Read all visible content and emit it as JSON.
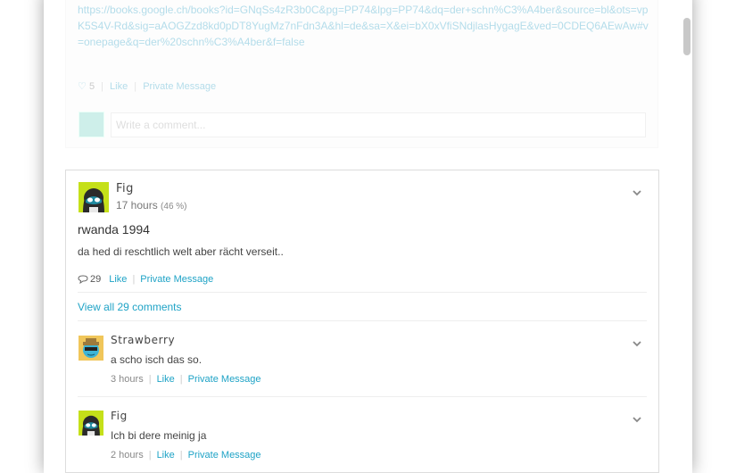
{
  "previous_post": {
    "link_text": "https://books.google.ch/books?id=GNqSs4zR3b0C&pg=PP74&lpg=PP74&dq=der+schn%C3%A4ber&source=bl&ots=vpK5S4V-Rd&sig=aAOGZzd8kd0pDT8YugMz7nFdn3A&hl=de&sa=X&ei=bX0xVfiSNdjlasHygagE&ved=0CDEQ6AEwAw#v=onepage&q=der%20schn%C3%A4ber&f=false",
    "likes_count": "5",
    "like_label": "Like",
    "pm_label": "Private Message",
    "comment_placeholder": "Write a comment..."
  },
  "post": {
    "author": "Fig",
    "time": "17 hours",
    "percent": "(46 %)",
    "title": "rwanda 1994",
    "body": "da hed di reschtlich welt aber rächt verseit..",
    "comment_count": "29",
    "like_label": "Like",
    "pm_label": "Private Message",
    "view_all_label": "View all 29 comments"
  },
  "comments": [
    {
      "author": "Strawberry",
      "text": "a scho isch das so.",
      "time": "3 hours",
      "like_label": "Like",
      "pm_label": "Private Message"
    },
    {
      "author": "Fig",
      "text": "Ich bi dere meinig ja",
      "time": "2 hours",
      "like_label": "Like",
      "pm_label": "Private Message"
    }
  ],
  "icons": {
    "fig_avatar": "fig-ghost-avatar",
    "strawberry_avatar": "strawberry-ghost-avatar",
    "chevron": "chevron-down-icon",
    "comment": "speech-bubble-icon",
    "heart": "heart-icon"
  },
  "colors": {
    "accent": "#1fa3c6",
    "fig_avatar_bg": "#c5e019",
    "strawberry_avatar_bg": "#f0c65a"
  }
}
